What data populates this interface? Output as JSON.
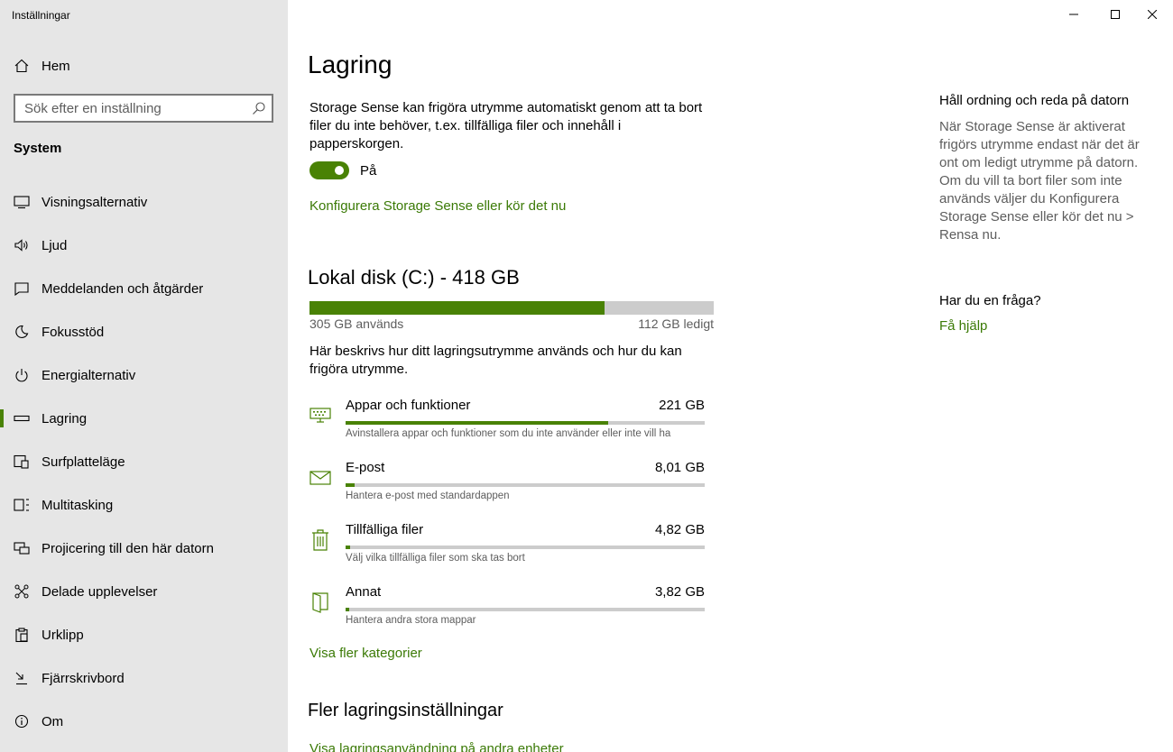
{
  "window": {
    "title": "Inställningar"
  },
  "sidebar": {
    "home_label": "Hem",
    "search_placeholder": "Sök efter en inställning",
    "section_label": "System",
    "items": [
      {
        "label": "Visningsalternativ",
        "icon": "monitor-icon"
      },
      {
        "label": "Ljud",
        "icon": "speaker-icon"
      },
      {
        "label": "Meddelanden och åtgärder",
        "icon": "notification-icon"
      },
      {
        "label": "Fokusstöd",
        "icon": "moon-icon"
      },
      {
        "label": "Energialternativ",
        "icon": "power-icon"
      },
      {
        "label": "Lagring",
        "icon": "storage-icon",
        "active": true
      },
      {
        "label": "Surfplatteläge",
        "icon": "tablet-icon"
      },
      {
        "label": "Multitasking",
        "icon": "multitasking-icon"
      },
      {
        "label": "Projicering till den här datorn",
        "icon": "projection-icon"
      },
      {
        "label": "Delade upplevelser",
        "icon": "shared-icon"
      },
      {
        "label": "Urklipp",
        "icon": "clipboard-icon"
      },
      {
        "label": "Fjärrskrivbord",
        "icon": "remote-desktop-icon"
      },
      {
        "label": "Om",
        "icon": "info-icon"
      }
    ]
  },
  "main": {
    "title": "Lagring",
    "storage_sense_desc": "Storage Sense kan frigöra utrymme automatiskt genom att ta bort filer du inte behöver, t.ex. tillfälliga filer och innehåll i papperskorgen.",
    "toggle_label": "På",
    "toggle_on": true,
    "configure_link": "Konfigurera Storage Sense eller kör det nu",
    "disk": {
      "title": "Lokal disk (C:) - 418 GB",
      "used_label": "305 GB används",
      "free_label": "112 GB ledigt",
      "used_fraction": 0.73
    },
    "disk_desc": "Här beskrivs hur ditt lagringsutrymme används och hur du kan frigöra utrymme.",
    "categories": [
      {
        "name": "Appar och funktioner",
        "size": "221 GB",
        "sub": "Avinstallera appar och funktioner som du inte använder eller inte vill ha",
        "fraction": 0.73,
        "icon": "apps-icon"
      },
      {
        "name": "E-post",
        "size": "8,01 GB",
        "sub": "Hantera e-post med standardappen",
        "fraction": 0.025,
        "icon": "mail-icon"
      },
      {
        "name": "Tillfälliga filer",
        "size": "4,82 GB",
        "sub": "Välj vilka tillfälliga filer som ska tas bort",
        "fraction": 0.013,
        "icon": "trash-icon"
      },
      {
        "name": "Annat",
        "size": "3,82 GB",
        "sub": "Hantera andra stora mappar",
        "fraction": 0.01,
        "icon": "folder-icon"
      }
    ],
    "more_categories_link": "Visa fler kategorier",
    "more_settings_title": "Fler lagringsinställningar",
    "other_drives_link": "Visa lagringsanvändning på andra enheter"
  },
  "right_panel": {
    "heading": "Håll ordning och reda på datorn",
    "paragraph": "När Storage Sense är aktiverat frigörs utrymme endast när det är ont om ledigt utrymme på datorn. Om du vill ta bort filer som inte används väljer du Konfigurera Storage Sense eller kör det nu > Rensa nu.",
    "question_heading": "Har du en fråga?",
    "help_link": "Få hjälp"
  },
  "colors": {
    "accent": "#498205",
    "sidebar_bg": "#e6e6e6",
    "bar_bg": "#cccccc"
  }
}
